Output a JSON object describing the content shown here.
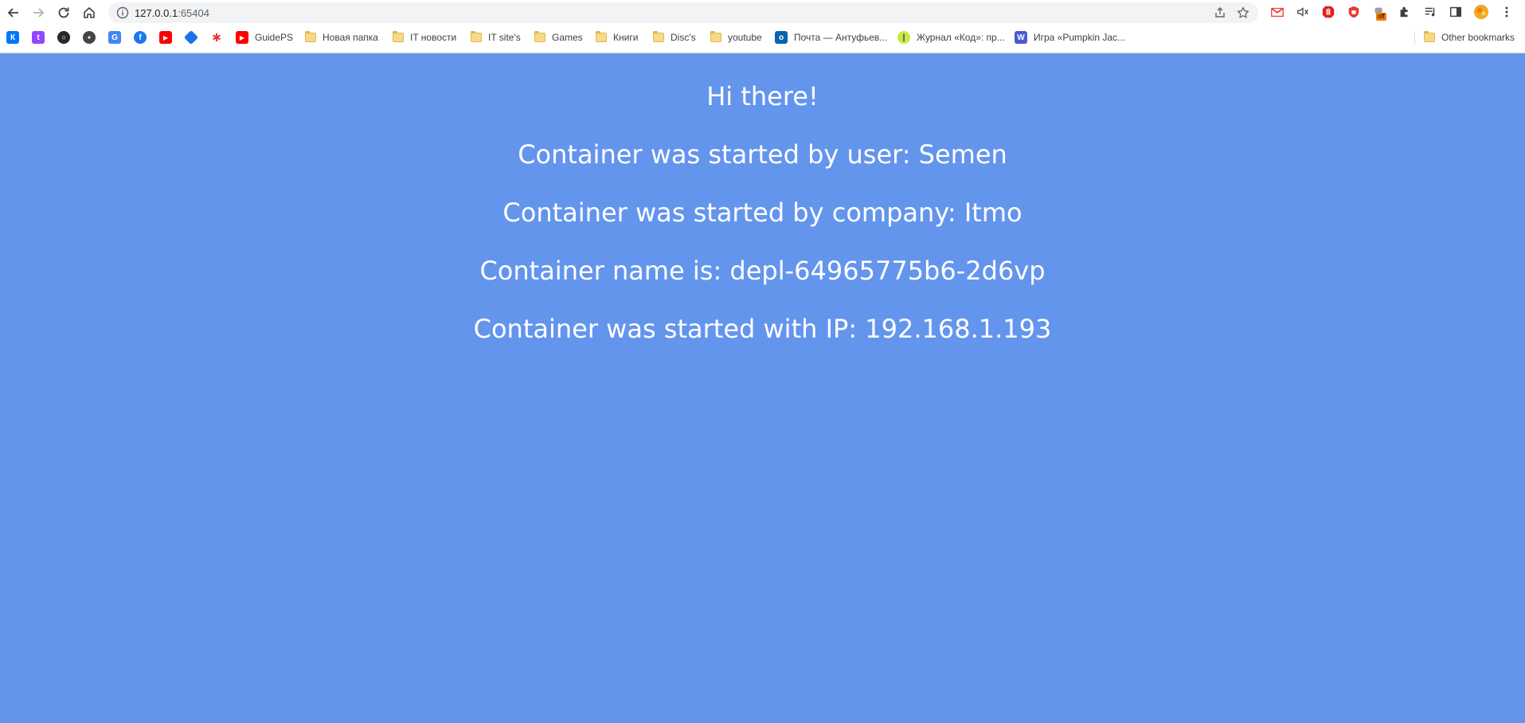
{
  "browser": {
    "url_host": "127.0.0.1",
    "url_port": ":65404",
    "colors": {
      "page_background": "#6495ed",
      "text": "#ffffff"
    },
    "bookmarks": [
      {
        "label": "",
        "icon": "vk-icon"
      },
      {
        "label": "",
        "icon": "twitch-icon"
      },
      {
        "label": "",
        "icon": "github-icon"
      },
      {
        "label": "",
        "icon": "badge-icon"
      },
      {
        "label": "",
        "icon": "translate-icon"
      },
      {
        "label": "",
        "icon": "facebook-icon"
      },
      {
        "label": "",
        "icon": "youtube-icon"
      },
      {
        "label": "",
        "icon": "diamond-icon"
      },
      {
        "label": "",
        "icon": "star-app-icon"
      },
      {
        "label": "GuidePS",
        "icon": "youtube-icon"
      },
      {
        "label": "Новая папка",
        "icon": "folder-icon"
      },
      {
        "label": "IT новости",
        "icon": "folder-icon"
      },
      {
        "label": "IT site's",
        "icon": "folder-icon"
      },
      {
        "label": "Games",
        "icon": "folder-icon"
      },
      {
        "label": "Книги",
        "icon": "folder-icon"
      },
      {
        "label": "Disc's",
        "icon": "folder-icon"
      },
      {
        "label": "youtube",
        "icon": "folder-icon"
      },
      {
        "label": "Почта — Антуфьев...",
        "icon": "outlook-icon"
      },
      {
        "label": "Журнал «Код»: пр...",
        "icon": "kod-icon"
      },
      {
        "label": "Игра «Pumpkin Jac...",
        "icon": "w-icon"
      }
    ],
    "other_bookmarks": "Other bookmarks",
    "extension_badge": "off"
  },
  "page": {
    "greeting": "Hi there!",
    "user_line": "Container was started by user: Semen",
    "company_line": "Container was started by company: Itmo",
    "name_line": "Container name is: depl-64965775b6-2d6vp",
    "ip_line": "Container was started with IP: 192.168.1.193"
  }
}
